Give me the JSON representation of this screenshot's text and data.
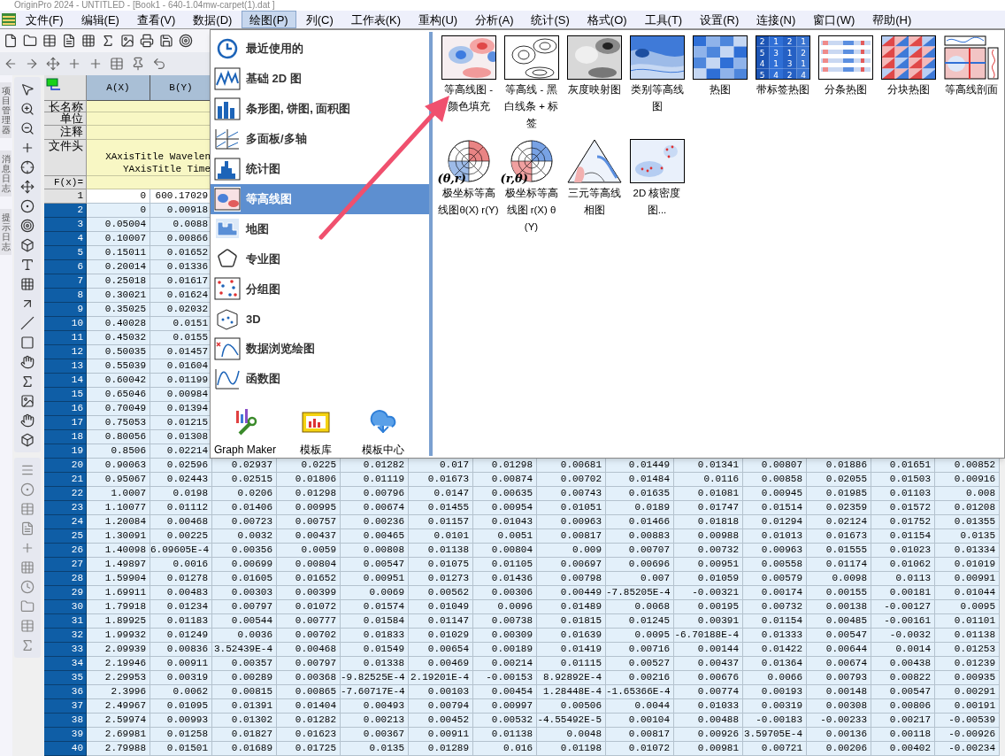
{
  "title_bar": {
    "title": "OriginPro 2024 - UNTITLED - [Book1 - 640-1.04mw-carpet(1).dat ]"
  },
  "menu_bar": [
    {
      "label": "文件(F)",
      "selected": false
    },
    {
      "label": "编辑(E)",
      "selected": false
    },
    {
      "label": "查看(V)",
      "selected": false
    },
    {
      "label": "数据(D)",
      "selected": false
    },
    {
      "label": "绘图(P)",
      "selected": true
    },
    {
      "label": "列(C)",
      "selected": false
    },
    {
      "label": "工作表(K)",
      "selected": false
    },
    {
      "label": "重构(U)",
      "selected": false
    },
    {
      "label": "分析(A)",
      "selected": false
    },
    {
      "label": "统计(S)",
      "selected": false
    },
    {
      "label": "格式(O)",
      "selected": false
    },
    {
      "label": "工具(T)",
      "selected": false
    },
    {
      "label": "设置(R)",
      "selected": false
    },
    {
      "label": "连接(N)",
      "selected": false
    },
    {
      "label": "窗口(W)",
      "selected": false
    },
    {
      "label": "帮助(H)",
      "selected": false
    }
  ],
  "side_tabs": [
    "项目管理器",
    "消息日志",
    "提示日志"
  ],
  "worksheet": {
    "columns": [
      "A(X)",
      "B(Y)"
    ],
    "label_rows": [
      "长名称",
      "单位",
      "注释",
      "文件头"
    ],
    "formula_row": "F(x)=",
    "file_header_lines": [
      "XAxisTitle Wavelen",
      "YAxisTitle Time"
    ],
    "rows": [
      {
        "index": "1",
        "selected": false,
        "cells": [
          "0",
          "600.17029"
        ]
      },
      {
        "index": "2",
        "selected": true,
        "cells": [
          "0",
          "0.00918"
        ]
      },
      {
        "index": "3",
        "selected": true,
        "cells": [
          "0.05004",
          "0.0088"
        ]
      },
      {
        "index": "4",
        "selected": true,
        "cells": [
          "0.10007",
          "0.00866"
        ]
      },
      {
        "index": "5",
        "selected": true,
        "cells": [
          "0.15011",
          "0.01652"
        ]
      },
      {
        "index": "6",
        "selected": true,
        "cells": [
          "0.20014",
          "0.01336"
        ]
      },
      {
        "index": "7",
        "selected": true,
        "cells": [
          "0.25018",
          "0.01617"
        ]
      },
      {
        "index": "8",
        "selected": true,
        "cells": [
          "0.30021",
          "0.01624"
        ]
      },
      {
        "index": "9",
        "selected": true,
        "cells": [
          "0.35025",
          "0.02032"
        ]
      },
      {
        "index": "10",
        "selected": true,
        "cells": [
          "0.40028",
          "0.0151"
        ]
      },
      {
        "index": "11",
        "selected": true,
        "cells": [
          "0.45032",
          "0.0155"
        ]
      },
      {
        "index": "12",
        "selected": true,
        "cells": [
          "0.50035",
          "0.01457"
        ]
      },
      {
        "index": "13",
        "selected": true,
        "cells": [
          "0.55039",
          "0.01604"
        ]
      },
      {
        "index": "14",
        "selected": true,
        "cells": [
          "0.60042",
          "0.01199"
        ]
      },
      {
        "index": "15",
        "selected": true,
        "cells": [
          "0.65046",
          "0.00984"
        ]
      },
      {
        "index": "16",
        "selected": true,
        "cells": [
          "0.70049",
          "0.01394"
        ]
      },
      {
        "index": "17",
        "selected": true,
        "cells": [
          "0.75053",
          "0.01215"
        ]
      },
      {
        "index": "18",
        "selected": true,
        "cells": [
          "0.80056",
          "0.01308"
        ]
      },
      {
        "index": "19",
        "selected": true,
        "cells": [
          "0.8506",
          "0.02214"
        ]
      },
      {
        "index": "20",
        "selected": true,
        "cells": [
          "0.90063",
          "0.02596",
          "0.02937",
          "0.0225",
          "0.01282",
          "0.017",
          "0.01298",
          "0.00681",
          "0.01449",
          "0.01341",
          "0.00807",
          "0.01886",
          "0.01651",
          "0.00852"
        ]
      },
      {
        "index": "21",
        "selected": true,
        "cells": [
          "0.95067",
          "0.02443",
          "0.02515",
          "0.01806",
          "0.01119",
          "0.01673",
          "0.00874",
          "0.00702",
          "0.01484",
          "0.0116",
          "0.00858",
          "0.02055",
          "0.01503",
          "0.00916"
        ]
      },
      {
        "index": "22",
        "selected": true,
        "cells": [
          "1.0007",
          "0.0198",
          "0.0206",
          "0.01298",
          "0.00796",
          "0.0147",
          "0.00635",
          "0.00743",
          "0.01635",
          "0.01081",
          "0.00945",
          "0.01985",
          "0.01103",
          "0.008"
        ]
      },
      {
        "index": "23",
        "selected": true,
        "cells": [
          "1.10077",
          "0.01112",
          "0.01406",
          "0.00995",
          "0.00674",
          "0.01455",
          "0.00954",
          "0.01051",
          "0.0189",
          "0.01747",
          "0.01514",
          "0.02359",
          "0.01572",
          "0.01208"
        ]
      },
      {
        "index": "24",
        "selected": true,
        "cells": [
          "1.20084",
          "0.00468",
          "0.00723",
          "0.00757",
          "0.00236",
          "0.01157",
          "0.01043",
          "0.00963",
          "0.01466",
          "0.01818",
          "0.01294",
          "0.02124",
          "0.01752",
          "0.01355"
        ]
      },
      {
        "index": "25",
        "selected": true,
        "cells": [
          "1.30091",
          "0.00225",
          "0.0032",
          "0.00437",
          "0.00465",
          "0.0101",
          "0.0051",
          "0.00817",
          "0.00883",
          "0.00988",
          "0.01013",
          "0.01673",
          "0.01154",
          "0.0135"
        ]
      },
      {
        "index": "26",
        "selected": true,
        "cells": [
          "1.40098",
          "6.09605E-4",
          "0.00356",
          "0.0059",
          "0.00808",
          "0.01138",
          "0.00804",
          "0.009",
          "0.00707",
          "0.00732",
          "0.00963",
          "0.01555",
          "0.01023",
          "0.01334"
        ]
      },
      {
        "index": "27",
        "selected": true,
        "cells": [
          "1.49897",
          "0.0016",
          "0.00699",
          "0.00804",
          "0.00547",
          "0.01075",
          "0.01105",
          "0.00697",
          "0.00696",
          "0.00951",
          "0.00558",
          "0.01174",
          "0.01062",
          "0.01019"
        ]
      },
      {
        "index": "28",
        "selected": true,
        "cells": [
          "1.59904",
          "0.01278",
          "0.01605",
          "0.01652",
          "0.00951",
          "0.01273",
          "0.01436",
          "0.00798",
          "0.007",
          "0.01059",
          "0.00579",
          "0.0098",
          "0.0113",
          "0.00991"
        ]
      },
      {
        "index": "29",
        "selected": true,
        "cells": [
          "1.69911",
          "0.00483",
          "0.00303",
          "0.00399",
          "0.0069",
          "0.00562",
          "0.00306",
          "0.00449",
          "-7.85205E-4",
          "-0.00321",
          "0.00174",
          "0.00155",
          "0.00181",
          "0.01044"
        ]
      },
      {
        "index": "30",
        "selected": true,
        "cells": [
          "1.79918",
          "0.01234",
          "0.00797",
          "0.01072",
          "0.01574",
          "0.01049",
          "0.0096",
          "0.01489",
          "0.0068",
          "0.00195",
          "0.00732",
          "0.00138",
          "-0.00127",
          "0.0095"
        ]
      },
      {
        "index": "31",
        "selected": true,
        "cells": [
          "1.89925",
          "0.01183",
          "0.00544",
          "0.00777",
          "0.01584",
          "0.01147",
          "0.00738",
          "0.01815",
          "0.01245",
          "0.00391",
          "0.01154",
          "0.00485",
          "-0.00161",
          "0.01101"
        ]
      },
      {
        "index": "32",
        "selected": true,
        "cells": [
          "1.99932",
          "0.01249",
          "0.0036",
          "0.00702",
          "0.01833",
          "0.01029",
          "0.00309",
          "0.01639",
          "0.0095",
          "-6.70188E-4",
          "0.01333",
          "0.00547",
          "-0.0032",
          "0.01138"
        ]
      },
      {
        "index": "33",
        "selected": true,
        "cells": [
          "2.09939",
          "0.00836",
          "3.52439E-4",
          "0.00468",
          "0.01549",
          "0.00654",
          "0.00189",
          "0.01419",
          "0.00716",
          "0.00144",
          "0.01422",
          "0.00644",
          "0.0014",
          "0.01253"
        ]
      },
      {
        "index": "34",
        "selected": true,
        "cells": [
          "2.19946",
          "0.00911",
          "0.00357",
          "0.00797",
          "0.01338",
          "0.00469",
          "0.00214",
          "0.01115",
          "0.00527",
          "0.00437",
          "0.01364",
          "0.00674",
          "0.00438",
          "0.01239"
        ]
      },
      {
        "index": "35",
        "selected": true,
        "cells": [
          "2.29953",
          "0.00319",
          "0.00289",
          "0.00368",
          "-9.82525E-4",
          "2.19201E-4",
          "-0.00153",
          "8.92892E-4",
          "0.00216",
          "0.00676",
          "0.0066",
          "0.00793",
          "0.00822",
          "0.00935"
        ]
      },
      {
        "index": "36",
        "selected": true,
        "cells": [
          "2.3996",
          "0.0062",
          "0.00815",
          "0.00865",
          "-7.60717E-4",
          "0.00103",
          "0.00454",
          "1.28448E-4",
          "-1.65366E-4",
          "0.00774",
          "0.00193",
          "0.00148",
          "0.00547",
          "0.00291"
        ]
      },
      {
        "index": "37",
        "selected": true,
        "cells": [
          "2.49967",
          "0.01095",
          "0.01391",
          "0.01404",
          "0.00493",
          "0.00794",
          "0.00997",
          "0.00506",
          "0.0044",
          "0.01033",
          "0.00319",
          "0.00308",
          "0.00806",
          "0.00191"
        ]
      },
      {
        "index": "38",
        "selected": true,
        "cells": [
          "2.59974",
          "0.00993",
          "0.01302",
          "0.01282",
          "0.00213",
          "0.00452",
          "0.00532",
          "-4.55492E-5",
          "0.00104",
          "0.00488",
          "-0.00183",
          "-0.00233",
          "0.00217",
          "-0.00539"
        ]
      },
      {
        "index": "39",
        "selected": true,
        "cells": [
          "2.69981",
          "0.01258",
          "0.01827",
          "0.01623",
          "0.00367",
          "0.00911",
          "0.01138",
          "0.0048",
          "0.00817",
          "0.00926",
          "3.59705E-4",
          "0.00136",
          "0.00118",
          "-0.00926"
        ]
      },
      {
        "index": "40",
        "selected": true,
        "cells": [
          "2.79988",
          "0.01501",
          "0.01689",
          "0.01725",
          "0.0135",
          "0.01289",
          "0.016",
          "0.01198",
          "0.01072",
          "0.00981",
          "0.00721",
          "0.00206",
          "0.00402",
          "-0.00234"
        ]
      }
    ]
  },
  "plot_menu": {
    "categories": [
      {
        "label": "最近使用的",
        "selected": false
      },
      {
        "label": "基础 2D 图",
        "selected": false
      },
      {
        "label": "条形图, 饼图, 面积图",
        "selected": false
      },
      {
        "label": "多面板/多轴",
        "selected": false
      },
      {
        "label": "统计图",
        "selected": false
      },
      {
        "label": "等高线图",
        "selected": true
      },
      {
        "label": "地图",
        "selected": false
      },
      {
        "label": "专业图",
        "selected": false
      },
      {
        "label": "分组图",
        "selected": false
      },
      {
        "label": "3D",
        "selected": false
      },
      {
        "label": "数据浏览绘图",
        "selected": false
      },
      {
        "label": "函数图",
        "selected": false
      }
    ],
    "tools": [
      "Graph Maker",
      "模板库",
      "模板中心"
    ],
    "gallery": [
      {
        "kind": "contour-fill",
        "label": "等高线图 - 颜色填充"
      },
      {
        "kind": "contour-lines",
        "label": "等高线 - 黑白线条 + 标签"
      },
      {
        "kind": "gray-map",
        "label": "灰度映射图"
      },
      {
        "kind": "category-contour",
        "label": "类别等高线图"
      },
      {
        "kind": "heatmap",
        "label": "热图"
      },
      {
        "kind": "labeled-heatmap",
        "label": "带标签热图",
        "grid": [
          "2",
          "1",
          "2",
          "1",
          "5",
          "3",
          "1",
          "2",
          "4",
          "1",
          "3",
          "1",
          "5",
          "4",
          "2",
          "4"
        ]
      },
      {
        "kind": "strip-heatmap",
        "label": "分条热图"
      },
      {
        "kind": "block-heatmap",
        "label": "分块热图"
      },
      {
        "kind": "profile",
        "label": "等高线剖面"
      },
      {
        "kind": "polar",
        "label": "极坐标等高线图θ(X) r(Y)",
        "badge": "(θ,r)"
      },
      {
        "kind": "polar-reverse",
        "label": "极坐标等高线图 r(X) θ(Y)",
        "badge": "(r,θ)"
      },
      {
        "kind": "ternary",
        "label": "三元等高线相图"
      },
      {
        "kind": "kde",
        "label": "2D 核密度图..."
      }
    ]
  }
}
